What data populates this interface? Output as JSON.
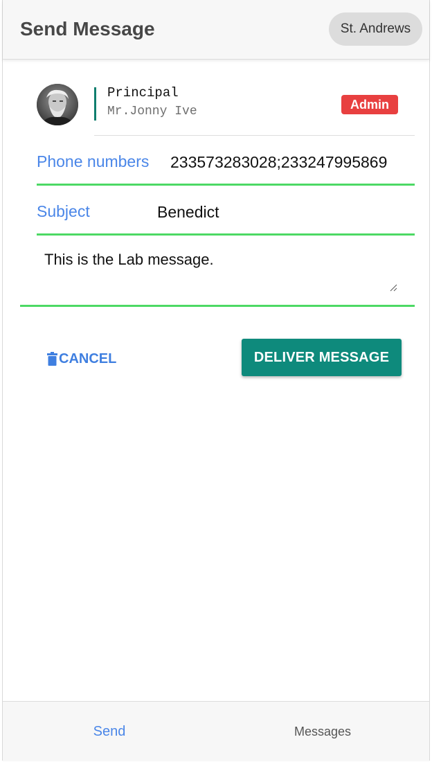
{
  "header": {
    "title": "Send Message",
    "school": "St. Andrews"
  },
  "profile": {
    "role": "Principal",
    "name": "Mr.Jonny Ive",
    "badge": "Admin"
  },
  "form": {
    "phone_label": "Phone numbers",
    "phone_value": "233573283028;233247995869",
    "subject_label": "Subject",
    "subject_value": "Benedict",
    "message_value": "This is the Lab message."
  },
  "actions": {
    "cancel_label": "CANCEL",
    "deliver_label": "DELIVER MESSAGE"
  },
  "tabs": {
    "send": "Send",
    "messages": "Messages"
  },
  "colors": {
    "accent": "#4a86e8",
    "primary": "#0e8a7c",
    "underline": "#4cd964",
    "badge": "#e84040"
  },
  "icons": {
    "cancel": "trash-icon",
    "avatar": "avatar-photo"
  }
}
